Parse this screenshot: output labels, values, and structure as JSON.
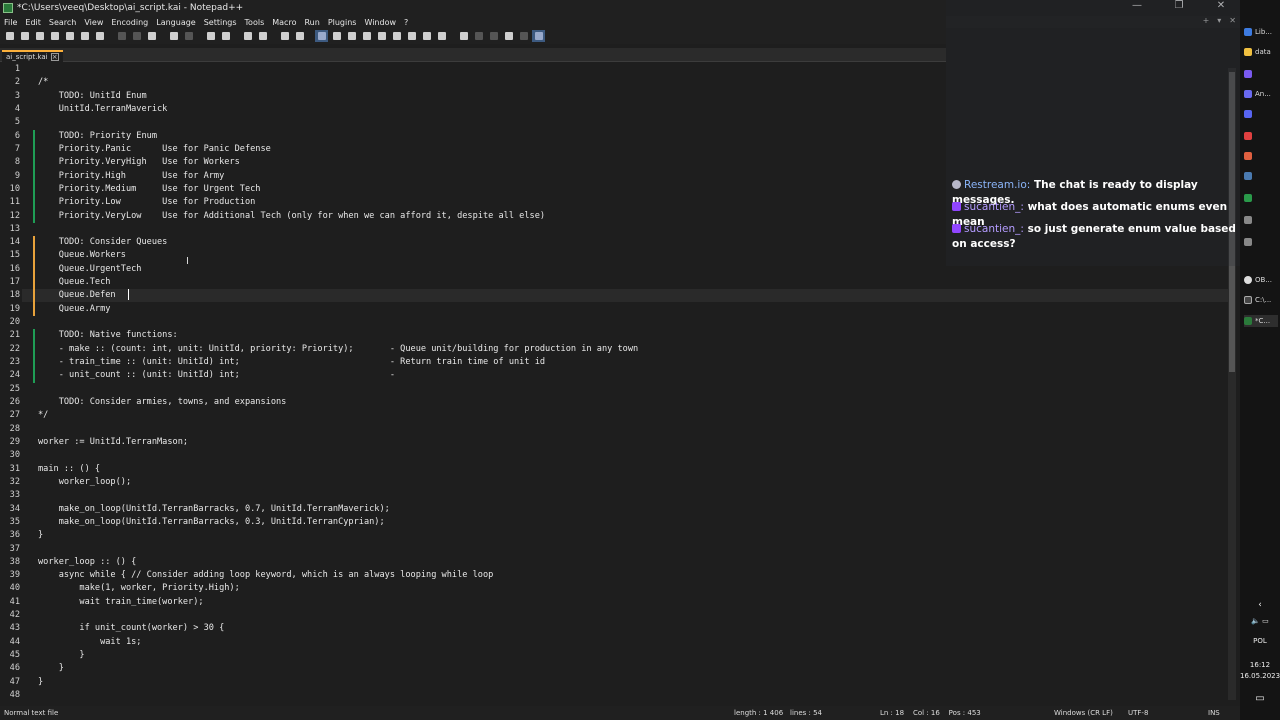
{
  "window": {
    "title": "*C:\\Users\\veeq\\Desktop\\ai_script.kai - Notepad++"
  },
  "menu": [
    "File",
    "Edit",
    "Search",
    "View",
    "Encoding",
    "Language",
    "Settings",
    "Tools",
    "Macro",
    "Run",
    "Plugins",
    "Window",
    "?"
  ],
  "menu_controls": [
    "+",
    "▾",
    "✕"
  ],
  "tab": {
    "label": "ai_script.kai"
  },
  "editor": {
    "current_line": 18,
    "lines": [
      "",
      "/*",
      "    TODO: UnitId Enum",
      "    UnitId.TerranMaverick",
      "",
      "    TODO: Priority Enum",
      "    Priority.Panic      Use for Panic Defense",
      "    Priority.VeryHigh   Use for Workers",
      "    Priority.High       Use for Army",
      "    Priority.Medium     Use for Urgent Tech",
      "    Priority.Low        Use for Production",
      "    Priority.VeryLow    Use for Additional Tech (only for when we can afford it, despite all else)",
      "",
      "    TODO: Consider Queues",
      "    Queue.Workers",
      "    Queue.UrgentTech",
      "    Queue.Tech",
      "    Queue.Defen",
      "    Queue.Army",
      "",
      "    TODO: Native functions:",
      "    - make :: (count: int, unit: UnitId, priority: Priority);       - Queue unit/building for production in any town",
      "    - train_time :: (unit: UnitId) int;                             - Return train time of unit id",
      "    - unit_count :: (unit: UnitId) int;                             -",
      "",
      "    TODO: Consider armies, towns, and expansions",
      "*/",
      "",
      "worker := UnitId.TerranMason;",
      "",
      "main :: () {",
      "    worker_loop();",
      "",
      "    make_on_loop(UnitId.TerranBarracks, 0.7, UnitId.TerranMaverick);",
      "    make_on_loop(UnitId.TerranBarracks, 0.3, UnitId.TerranCyprian);",
      "}",
      "",
      "worker_loop :: () {",
      "    async while { // Consider adding loop keyword, which is an always looping while loop",
      "        make(1, worker, Priority.High);",
      "        wait train_time(worker);",
      "",
      "        if unit_count(worker) > 30 {",
      "            wait 1s;",
      "        }",
      "    }",
      "}",
      ""
    ]
  },
  "chat": {
    "messages": [
      {
        "user": "Restream.io:",
        "text": "The chat is ready to display messages.",
        "platform": "restream"
      },
      {
        "user": "sucantien_:",
        "text": "what does automatic enums even mean",
        "platform": "twitch"
      },
      {
        "user": "sucantien_:",
        "text": "so just generate enum value based on access?",
        "platform": "twitch"
      }
    ]
  },
  "taskbar": {
    "items": [
      "Lib...",
      "data",
      "",
      "An...",
      "",
      "",
      "",
      "",
      "",
      "",
      "",
      "OB...",
      "C:\\...",
      "*C..."
    ],
    "language": "POL",
    "time": "16:12",
    "date": "16.05.2023"
  },
  "status": {
    "file_type": "Normal text file",
    "length": "length : 1 406",
    "lines": "lines : 54",
    "position": "Ln : 18    Col : 16    Pos : 453",
    "eol": "Windows (CR LF)",
    "encoding": "UTF-8",
    "mode": "INS"
  }
}
